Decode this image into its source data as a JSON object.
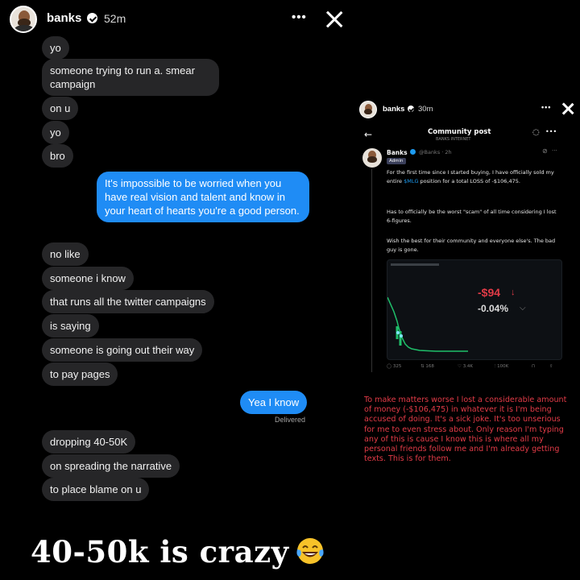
{
  "story": {
    "username": "banks",
    "time": "52m",
    "more": "•••"
  },
  "messages": {
    "m1": "yo",
    "m2": "someone trying to run a. smear campaign",
    "m3": "on u",
    "m4": "yo",
    "m5": "bro",
    "sent1": "It's impossible to be worried when you have real vision and talent and know in your heart of hearts you're a good person.",
    "m6": "no like",
    "m7": "someone i know",
    "m8": "that runs all the twitter campaigns",
    "m9": "is saying",
    "m10": "someone is going out their way",
    "m11": "to pay pages",
    "sent2": "Yea I know",
    "delivered": "Delivered",
    "m12": "dropping 40-50K",
    "m13": "on spreading the narrative",
    "m14": "to place blame on u"
  },
  "caption": "40-50k is crazy",
  "inset_story": {
    "username": "banks",
    "time": "30m",
    "more": "•••"
  },
  "community": {
    "title": "Community post",
    "subtitle": "BANKS INTERNET",
    "author": "Banks",
    "handle": "@Banks · 2h",
    "badge": "Admin",
    "para1_pre": "For the first time since I started buying, I have officially sold my entire ",
    "ticker": "$MLG",
    "para1_post": " position for a total LOSS of -$106,475.",
    "para2": "Has to officially be the worst \"scam\" of all time considering I lost 6-figures.",
    "para3": "Wish the best for their community and everyone else's. The bad guy is gone.",
    "chart_price": "-$94",
    "chart_change": "-0.04%",
    "stats": [
      "325",
      "168",
      "3.4K",
      "100K"
    ]
  },
  "red_note": "To make matters worse I lost a considerable amount of money (-$106,475) in whatever it is I'm being accused of doing. It's a sick joke. It's too unserious for me to even stress about. Only reason I'm typing any of this is cause I know this is where all my personal friends follow me and I'm already getting texts. This is for them.",
  "colors": {
    "sent_bubble": "#1f8cf5",
    "received_bubble": "#262628",
    "red_text": "#e23b47",
    "link": "#1d9bf0"
  }
}
